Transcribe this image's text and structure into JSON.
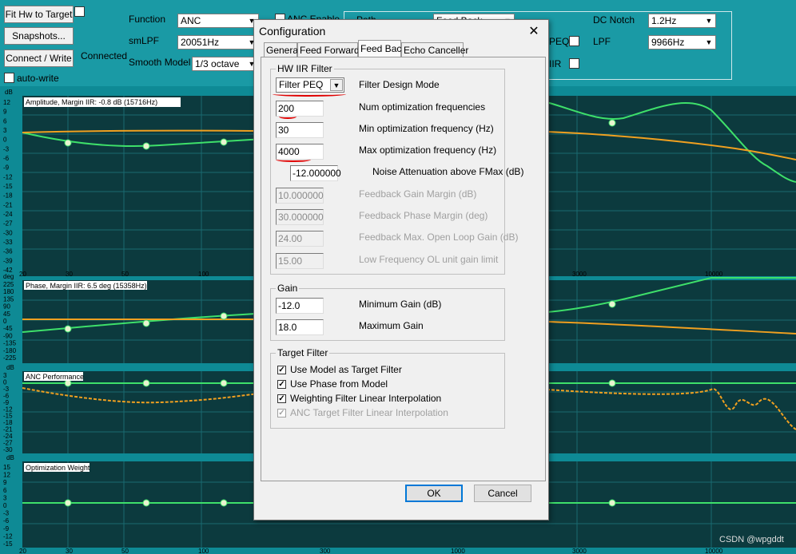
{
  "toolbar": {
    "fit_hw_label": "Fit Hw to Target",
    "snapshots_label": "Snapshots...",
    "connect_label": "Connect / Write",
    "connected_text": "Connected",
    "auto_write_label": "auto-write",
    "function_label": "Function",
    "function_value": "ANC",
    "smlpf_label": "smLPF",
    "smlpf_value": "20051Hz",
    "smooth_label": "Smooth Model",
    "smooth_value": "1/3 octave",
    "anc_enable_label": "ANC Enable",
    "path_label": "Path",
    "path_value": "Feed Back",
    "peq_label": "PEQ",
    "iir_label": "IIR",
    "dc_notch_label": "DC Notch",
    "dc_notch_value": "1.2Hz",
    "lpf_label": "LPF",
    "lpf_value": "9966Hz"
  },
  "plots": {
    "amplitude_title": "Amplitude, Margin IIR: -0.8 dB (15716Hz)",
    "phase_title": "Phase, Margin IIR: 6.5 deg (15358Hz)",
    "anc_title": "ANC Performance",
    "weight_title": "Optimization Weight",
    "db_unit": "dB",
    "deg_unit": "deg",
    "amp_ticks": [
      "12",
      "9",
      "6",
      "3",
      "0",
      "-3",
      "-6",
      "-9",
      "-12",
      "-15",
      "-18",
      "-21",
      "-24",
      "-27",
      "-30",
      "-33",
      "-36",
      "-39",
      "-42"
    ],
    "phase_ticks": [
      "225",
      "180",
      "135",
      "90",
      "45",
      "0",
      "-45",
      "-90",
      "-135",
      "-180",
      "-225"
    ],
    "anc_ticks": [
      "3",
      "0",
      "-3",
      "-6",
      "-9",
      "-12",
      "-15",
      "-18",
      "-21",
      "-24",
      "-27",
      "-30"
    ],
    "weight_ticks": [
      "15",
      "12",
      "9",
      "6",
      "3",
      "0",
      "-3",
      "-6",
      "-9",
      "-12",
      "-15"
    ],
    "x_ticks_a": [
      "20",
      "30",
      "50",
      "100",
      "3000",
      "10000"
    ],
    "x_ticks_b": [
      "20",
      "30",
      "50",
      "100",
      "300",
      "1000",
      "3000",
      "10000"
    ],
    "accent_green": "#3ee06a",
    "accent_orange": "#f0a020",
    "plot_bg": "#0c3a3e"
  },
  "dialog": {
    "title": "Configuration",
    "tabs": [
      "General",
      "Feed Forward",
      "Feed Back",
      "Echo Canceller"
    ],
    "active_tab": "Feed Back",
    "hw_group_title": "HW IIR Filter",
    "filter_design_value": "Filter PEQ",
    "filter_design_label": "Filter Design Mode",
    "num_freq_value": "200",
    "num_freq_label": "Num optimization frequencies",
    "min_freq_value": "30",
    "min_freq_label": "Min optimization frequency (Hz)",
    "max_freq_value": "4000",
    "max_freq_label": "Max optimization frequency (Hz)",
    "noise_att_value": "-12.000000",
    "noise_att_label": "Noise Attenuation above FMax (dB)",
    "gain_margin_value": "10.000000",
    "gain_margin_label": "Feedback Gain Margin (dB)",
    "phase_margin_value": "30.000000",
    "phase_margin_label": "Feedback Phase Margin (deg)",
    "max_ol_value": "24.00",
    "max_ol_label": "Feedback Max. Open Loop Gain (dB)",
    "low_freq_value": "15.00",
    "low_freq_label": "Low Frequency OL unit gain limit",
    "gain_group_title": "Gain",
    "min_gain_value": "-12.0",
    "min_gain_label": "Minimum Gain (dB)",
    "max_gain_value": "18.0",
    "max_gain_label": "Maximum Gain",
    "target_group_title": "Target Filter",
    "use_model_label": "Use Model as Target Filter",
    "use_phase_label": "Use Phase from Model",
    "weighting_label": "Weighting Filter Linear Interpolation",
    "anc_target_label": "ANC Target Filter Linear Interpolation",
    "ok_label": "OK",
    "cancel_label": "Cancel"
  },
  "watermark": "CSDN @wpgddt"
}
